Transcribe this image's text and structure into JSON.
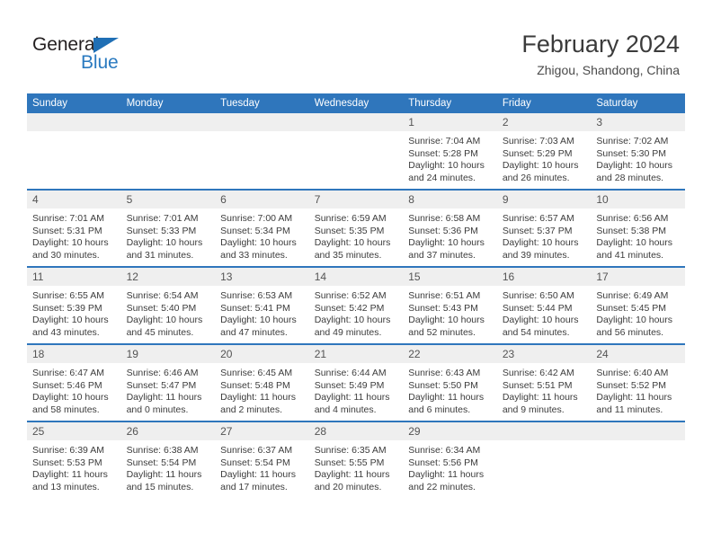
{
  "brand": {
    "name_part1": "General",
    "name_part2": "Blue",
    "logo_icon": "blue-triangle-icon"
  },
  "header": {
    "title": "February 2024",
    "subtitle": "Zhigou, Shandong, China"
  },
  "calendar": {
    "weekday_headers": [
      "Sunday",
      "Monday",
      "Tuesday",
      "Wednesday",
      "Thursday",
      "Friday",
      "Saturday"
    ],
    "accent_color": "#2f76bc",
    "datestrip_color": "#efefef",
    "weeks": [
      [
        {
          "day": "",
          "sunrise": "",
          "sunset": "",
          "daylight_line1": "",
          "daylight_line2": ""
        },
        {
          "day": "",
          "sunrise": "",
          "sunset": "",
          "daylight_line1": "",
          "daylight_line2": ""
        },
        {
          "day": "",
          "sunrise": "",
          "sunset": "",
          "daylight_line1": "",
          "daylight_line2": ""
        },
        {
          "day": "",
          "sunrise": "",
          "sunset": "",
          "daylight_line1": "",
          "daylight_line2": ""
        },
        {
          "day": "1",
          "sunrise": "Sunrise: 7:04 AM",
          "sunset": "Sunset: 5:28 PM",
          "daylight_line1": "Daylight: 10 hours",
          "daylight_line2": "and 24 minutes."
        },
        {
          "day": "2",
          "sunrise": "Sunrise: 7:03 AM",
          "sunset": "Sunset: 5:29 PM",
          "daylight_line1": "Daylight: 10 hours",
          "daylight_line2": "and 26 minutes."
        },
        {
          "day": "3",
          "sunrise": "Sunrise: 7:02 AM",
          "sunset": "Sunset: 5:30 PM",
          "daylight_line1": "Daylight: 10 hours",
          "daylight_line2": "and 28 minutes."
        }
      ],
      [
        {
          "day": "4",
          "sunrise": "Sunrise: 7:01 AM",
          "sunset": "Sunset: 5:31 PM",
          "daylight_line1": "Daylight: 10 hours",
          "daylight_line2": "and 30 minutes."
        },
        {
          "day": "5",
          "sunrise": "Sunrise: 7:01 AM",
          "sunset": "Sunset: 5:33 PM",
          "daylight_line1": "Daylight: 10 hours",
          "daylight_line2": "and 31 minutes."
        },
        {
          "day": "6",
          "sunrise": "Sunrise: 7:00 AM",
          "sunset": "Sunset: 5:34 PM",
          "daylight_line1": "Daylight: 10 hours",
          "daylight_line2": "and 33 minutes."
        },
        {
          "day": "7",
          "sunrise": "Sunrise: 6:59 AM",
          "sunset": "Sunset: 5:35 PM",
          "daylight_line1": "Daylight: 10 hours",
          "daylight_line2": "and 35 minutes."
        },
        {
          "day": "8",
          "sunrise": "Sunrise: 6:58 AM",
          "sunset": "Sunset: 5:36 PM",
          "daylight_line1": "Daylight: 10 hours",
          "daylight_line2": "and 37 minutes."
        },
        {
          "day": "9",
          "sunrise": "Sunrise: 6:57 AM",
          "sunset": "Sunset: 5:37 PM",
          "daylight_line1": "Daylight: 10 hours",
          "daylight_line2": "and 39 minutes."
        },
        {
          "day": "10",
          "sunrise": "Sunrise: 6:56 AM",
          "sunset": "Sunset: 5:38 PM",
          "daylight_line1": "Daylight: 10 hours",
          "daylight_line2": "and 41 minutes."
        }
      ],
      [
        {
          "day": "11",
          "sunrise": "Sunrise: 6:55 AM",
          "sunset": "Sunset: 5:39 PM",
          "daylight_line1": "Daylight: 10 hours",
          "daylight_line2": "and 43 minutes."
        },
        {
          "day": "12",
          "sunrise": "Sunrise: 6:54 AM",
          "sunset": "Sunset: 5:40 PM",
          "daylight_line1": "Daylight: 10 hours",
          "daylight_line2": "and 45 minutes."
        },
        {
          "day": "13",
          "sunrise": "Sunrise: 6:53 AM",
          "sunset": "Sunset: 5:41 PM",
          "daylight_line1": "Daylight: 10 hours",
          "daylight_line2": "and 47 minutes."
        },
        {
          "day": "14",
          "sunrise": "Sunrise: 6:52 AM",
          "sunset": "Sunset: 5:42 PM",
          "daylight_line1": "Daylight: 10 hours",
          "daylight_line2": "and 49 minutes."
        },
        {
          "day": "15",
          "sunrise": "Sunrise: 6:51 AM",
          "sunset": "Sunset: 5:43 PM",
          "daylight_line1": "Daylight: 10 hours",
          "daylight_line2": "and 52 minutes."
        },
        {
          "day": "16",
          "sunrise": "Sunrise: 6:50 AM",
          "sunset": "Sunset: 5:44 PM",
          "daylight_line1": "Daylight: 10 hours",
          "daylight_line2": "and 54 minutes."
        },
        {
          "day": "17",
          "sunrise": "Sunrise: 6:49 AM",
          "sunset": "Sunset: 5:45 PM",
          "daylight_line1": "Daylight: 10 hours",
          "daylight_line2": "and 56 minutes."
        }
      ],
      [
        {
          "day": "18",
          "sunrise": "Sunrise: 6:47 AM",
          "sunset": "Sunset: 5:46 PM",
          "daylight_line1": "Daylight: 10 hours",
          "daylight_line2": "and 58 minutes."
        },
        {
          "day": "19",
          "sunrise": "Sunrise: 6:46 AM",
          "sunset": "Sunset: 5:47 PM",
          "daylight_line1": "Daylight: 11 hours",
          "daylight_line2": "and 0 minutes."
        },
        {
          "day": "20",
          "sunrise": "Sunrise: 6:45 AM",
          "sunset": "Sunset: 5:48 PM",
          "daylight_line1": "Daylight: 11 hours",
          "daylight_line2": "and 2 minutes."
        },
        {
          "day": "21",
          "sunrise": "Sunrise: 6:44 AM",
          "sunset": "Sunset: 5:49 PM",
          "daylight_line1": "Daylight: 11 hours",
          "daylight_line2": "and 4 minutes."
        },
        {
          "day": "22",
          "sunrise": "Sunrise: 6:43 AM",
          "sunset": "Sunset: 5:50 PM",
          "daylight_line1": "Daylight: 11 hours",
          "daylight_line2": "and 6 minutes."
        },
        {
          "day": "23",
          "sunrise": "Sunrise: 6:42 AM",
          "sunset": "Sunset: 5:51 PM",
          "daylight_line1": "Daylight: 11 hours",
          "daylight_line2": "and 9 minutes."
        },
        {
          "day": "24",
          "sunrise": "Sunrise: 6:40 AM",
          "sunset": "Sunset: 5:52 PM",
          "daylight_line1": "Daylight: 11 hours",
          "daylight_line2": "and 11 minutes."
        }
      ],
      [
        {
          "day": "25",
          "sunrise": "Sunrise: 6:39 AM",
          "sunset": "Sunset: 5:53 PM",
          "daylight_line1": "Daylight: 11 hours",
          "daylight_line2": "and 13 minutes."
        },
        {
          "day": "26",
          "sunrise": "Sunrise: 6:38 AM",
          "sunset": "Sunset: 5:54 PM",
          "daylight_line1": "Daylight: 11 hours",
          "daylight_line2": "and 15 minutes."
        },
        {
          "day": "27",
          "sunrise": "Sunrise: 6:37 AM",
          "sunset": "Sunset: 5:54 PM",
          "daylight_line1": "Daylight: 11 hours",
          "daylight_line2": "and 17 minutes."
        },
        {
          "day": "28",
          "sunrise": "Sunrise: 6:35 AM",
          "sunset": "Sunset: 5:55 PM",
          "daylight_line1": "Daylight: 11 hours",
          "daylight_line2": "and 20 minutes."
        },
        {
          "day": "29",
          "sunrise": "Sunrise: 6:34 AM",
          "sunset": "Sunset: 5:56 PM",
          "daylight_line1": "Daylight: 11 hours",
          "daylight_line2": "and 22 minutes."
        },
        {
          "day": "",
          "sunrise": "",
          "sunset": "",
          "daylight_line1": "",
          "daylight_line2": ""
        },
        {
          "day": "",
          "sunrise": "",
          "sunset": "",
          "daylight_line1": "",
          "daylight_line2": ""
        }
      ]
    ]
  }
}
